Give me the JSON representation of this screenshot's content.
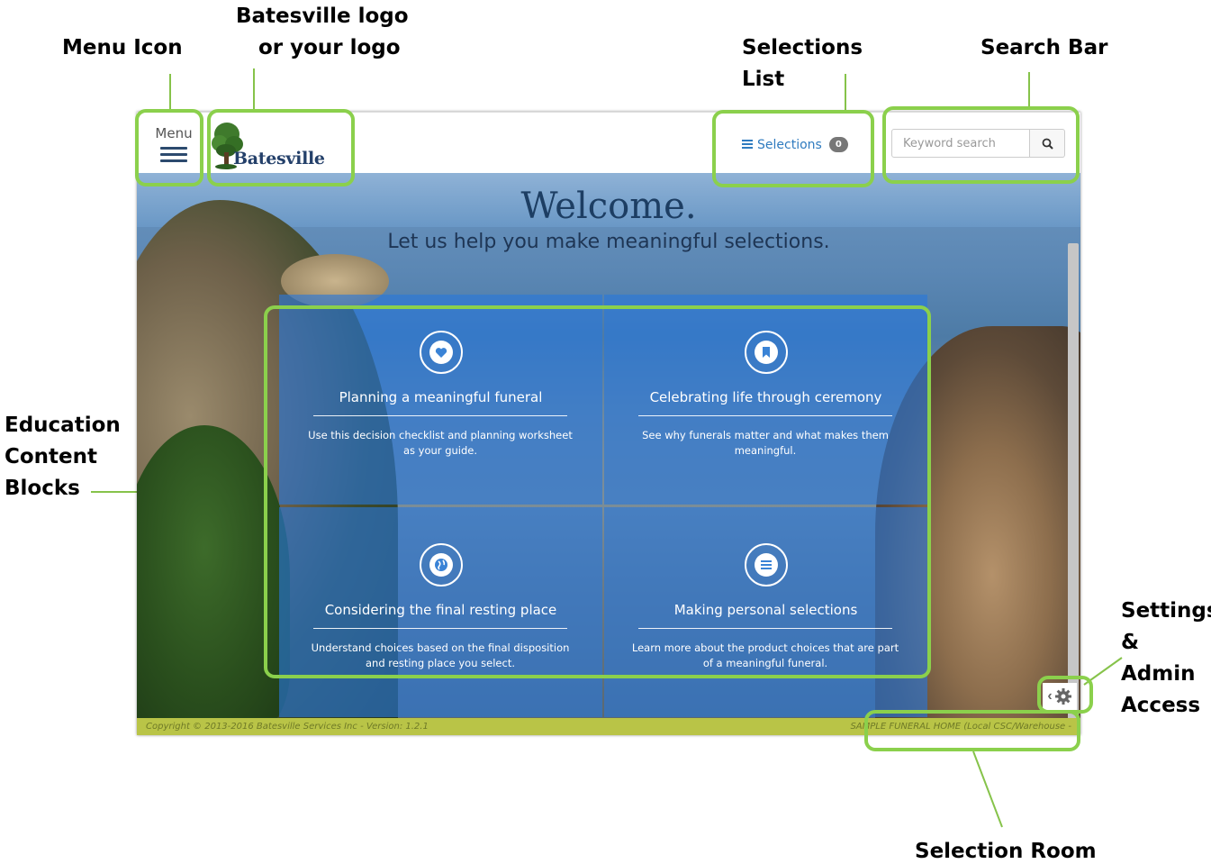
{
  "callouts": {
    "menu_icon": "Menu Icon",
    "logo_line1": "Batesville logo",
    "logo_line2": "or your logo",
    "selections_line1": "Selections",
    "selections_line2": "List",
    "search_bar": "Search Bar",
    "education_line1": "Education",
    "education_line2": "Content",
    "education_line3": "Blocks",
    "settings_line1": "Settings",
    "settings_line2": "&",
    "settings_line3": "Admin",
    "settings_line4": "Access",
    "selection_room": "Selection Room"
  },
  "header": {
    "menu_label": "Menu",
    "logo_text": "Batesville",
    "selections_label": "Selections",
    "selections_count": "0",
    "search_placeholder": "Keyword search"
  },
  "hero": {
    "welcome": "Welcome.",
    "tagline": "Let us help you make meaningful selections."
  },
  "blocks": [
    {
      "icon": "heart-icon",
      "title": "Planning a meaningful funeral",
      "description": "Use this decision checklist and planning worksheet as your guide."
    },
    {
      "icon": "bookmark-icon",
      "title": "Celebrating life through ceremony",
      "description": "See why funerals matter and what makes them meaningful."
    },
    {
      "icon": "globe-icon",
      "title": "Considering the final resting place",
      "description": "Understand choices based on the final disposition and resting place you select."
    },
    {
      "icon": "list-icon",
      "title": "Making personal selections",
      "description": "Learn more about the product choices that are part of a meaningful funeral."
    }
  ],
  "footer": {
    "copyright": "Copyright © 2013-2016 Batesville Services Inc - Version: 1.2.1",
    "location": "SAMPLE FUNERAL HOME (Local CSC/Warehouse -"
  },
  "colors": {
    "highlight": "#8bd04c",
    "block_bg": "#2878dc",
    "link_blue": "#2f7bbf"
  }
}
